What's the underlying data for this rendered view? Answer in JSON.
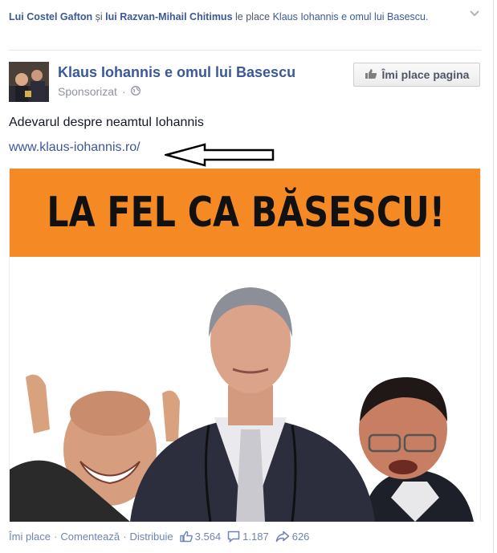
{
  "social_context": {
    "friend1": "Lui Costel Gafton",
    "conjunction": "și",
    "friend2": "lui Razvan-Mihail Chitimus",
    "verb": "le place",
    "page_link": "Klaus Iohannis e omul lui Basescu."
  },
  "post": {
    "page_name": "Klaus Iohannis e omul lui Basescu",
    "sponsored_label": "Sponsorizat",
    "like_page_label": "Îmi place pagina",
    "text": "Adevarul despre neamtul Iohannis",
    "link": "www.klaus-iohannis.ro/",
    "banner_text": "LA FEL CA BĂSESCU!"
  },
  "actions": {
    "like": "Îmi place",
    "comment": "Comentează",
    "share": "Distribuie",
    "separator": "·",
    "likes_count": "3.564",
    "comments_count": "1.187",
    "shares_count": "626"
  },
  "colors": {
    "link_blue": "#3b5998",
    "banner_orange": "#f58a24"
  }
}
